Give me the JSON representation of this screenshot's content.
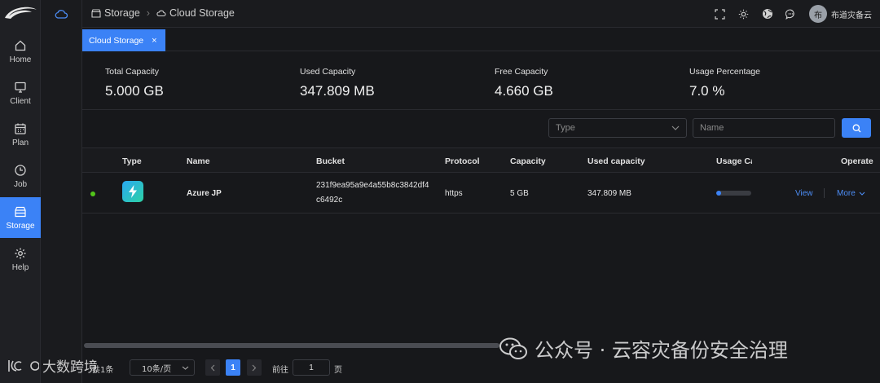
{
  "nav": {
    "items": [
      {
        "label": "Home",
        "icon": "home-icon"
      },
      {
        "label": "Client",
        "icon": "monitor-icon"
      },
      {
        "label": "Plan",
        "icon": "calendar-icon"
      },
      {
        "label": "Job",
        "icon": "clock-icon"
      },
      {
        "label": "Storage",
        "icon": "storage-icon",
        "active": true
      },
      {
        "label": "Help",
        "icon": "gear-icon"
      }
    ]
  },
  "breadcrumb": {
    "root": "Storage",
    "current": "Cloud Storage"
  },
  "header": {
    "user_avatar": "布",
    "user_name": "布道灾备云"
  },
  "tabs": [
    {
      "label": "Cloud Storage",
      "close": "×"
    }
  ],
  "stats": [
    {
      "title": "Total Capacity",
      "value": "5.000 GB"
    },
    {
      "title": "Used Capacity",
      "value": "347.809 MB"
    },
    {
      "title": "Free Capacity",
      "value": "4.660 GB"
    },
    {
      "title": "Usage Percentage",
      "value": "7.0 %"
    }
  ],
  "filters": {
    "type_placeholder": "Type",
    "name_placeholder": "Name"
  },
  "table": {
    "columns": [
      "Type",
      "Name",
      "Bucket",
      "Protocol",
      "Capacity",
      "Used capacity",
      "Usage Ca",
      "Operate"
    ],
    "rows": [
      {
        "status_color": "#52c41a",
        "type_icon": "azure-icon",
        "name": "Azure JP",
        "bucket_line1": "231f9ea95a9e4a55b8c3842df4",
        "bucket_line2": "c6492c",
        "protocol": "https",
        "capacity": "5 GB",
        "used_capacity": "347.809 MB",
        "usage_fraction": 0.07,
        "view": "View",
        "more": "More"
      }
    ]
  },
  "pagination": {
    "total_label": "共1条",
    "page_size": "10条/页",
    "current_page": "1",
    "goto_label": "前往",
    "goto_value": "1",
    "page_unit": "页"
  },
  "watermarks": {
    "right": "公众号 · 云容灾备份安全治理",
    "left": "大数跨境"
  },
  "colors": {
    "accent": "#3b82f6",
    "link": "#4c8df6",
    "status_ok": "#52c41a"
  }
}
